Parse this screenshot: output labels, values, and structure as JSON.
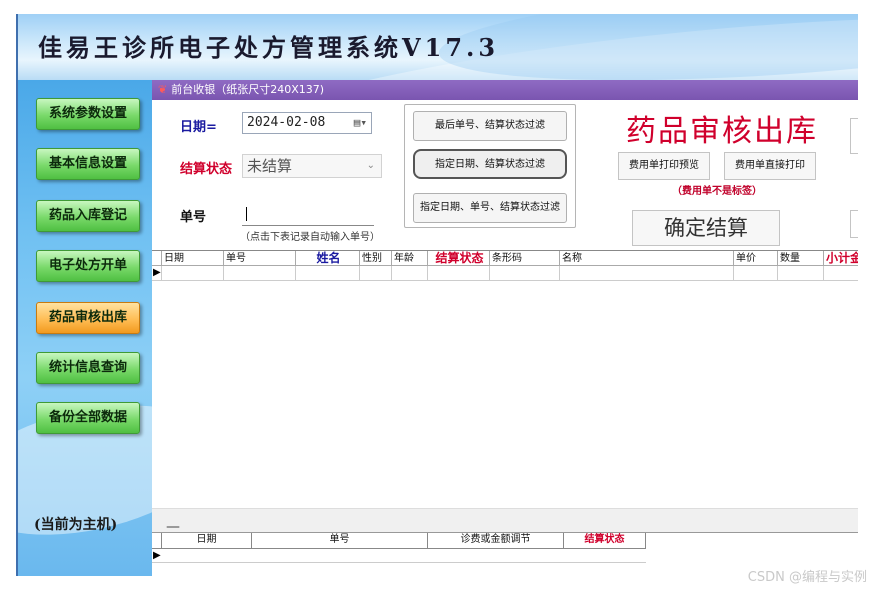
{
  "app": {
    "title": "佳易王诊所电子处方管理系统V17.3"
  },
  "sidebar": {
    "items": [
      {
        "label": "系统参数设置",
        "active": false
      },
      {
        "label": "基本信息设置",
        "active": false
      },
      {
        "label": "药品入库登记",
        "active": false
      },
      {
        "label": "电子处方开单",
        "active": false
      },
      {
        "label": "药品审核出库",
        "active": true
      },
      {
        "label": "统计信息查询",
        "active": false
      },
      {
        "label": "备份全部数据",
        "active": false
      }
    ],
    "host_status": "(当前为主机)"
  },
  "tab": {
    "icon": "leaf-icon",
    "label": "前台收银（纸张尺寸240X137)"
  },
  "form": {
    "date_label": "日期=",
    "date_value": "2024-02-08",
    "status_label": "结算状态",
    "status_value": "未结算",
    "number_label": "单号",
    "number_value": "",
    "number_hint": "（点击下表记录自动输入单号）"
  },
  "filters": {
    "btn1": "最后单号、结算状态过滤",
    "btn2": "指定日期、结算状态过滤",
    "btn3": "指定日期、单号、结算状态过滤"
  },
  "actions": {
    "page_title": "药品审核出库",
    "print_preview": "费用单打印预览",
    "print_direct": "费用单直接打印",
    "note": "（费用单不是标签）",
    "confirm": "确定结算"
  },
  "table_main": {
    "columns": [
      "日期",
      "单号",
      "姓名",
      "性别",
      "年龄",
      "结算状态",
      "条形码",
      "名称",
      "单价",
      "数量",
      "小计金"
    ],
    "rows": []
  },
  "table_detail": {
    "columns": [
      "日期",
      "单号",
      "诊费或金额调节",
      "结算状态"
    ],
    "rows": []
  },
  "divider_mark": "—",
  "watermark": "CSDN @编程与实例",
  "colors": {
    "accent_red": "#d0002c",
    "label_blue": "#1a1aa0",
    "tab_purple": "#7a55b0",
    "nav_green": "#79d96a",
    "nav_active": "#ffbd55"
  }
}
